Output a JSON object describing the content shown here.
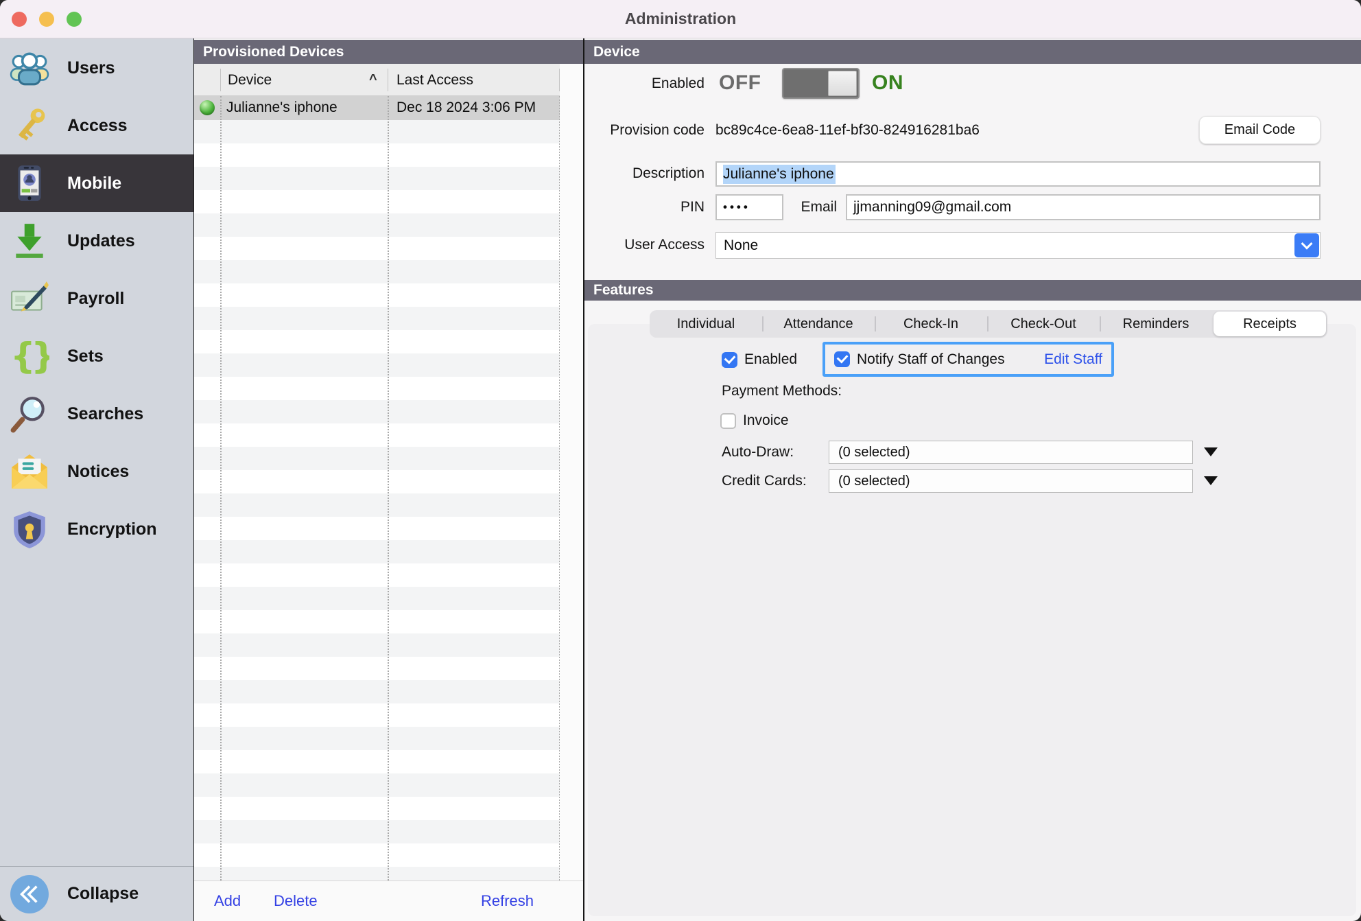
{
  "window": {
    "title": "Administration"
  },
  "sidebar": {
    "items": [
      {
        "label": "Users",
        "icon": "users-icon"
      },
      {
        "label": "Access",
        "icon": "key-icon"
      },
      {
        "label": "Mobile",
        "icon": "mobile-icon",
        "selected": true
      },
      {
        "label": "Updates",
        "icon": "download-icon"
      },
      {
        "label": "Payroll",
        "icon": "check-pen-icon"
      },
      {
        "label": "Sets",
        "icon": "braces-icon"
      },
      {
        "label": "Searches",
        "icon": "magnifier-icon"
      },
      {
        "label": "Notices",
        "icon": "envelope-icon"
      },
      {
        "label": "Encryption",
        "icon": "shield-icon"
      }
    ],
    "collapse_label": "Collapse"
  },
  "devices_panel": {
    "header": "Provisioned Devices",
    "table": {
      "columns": [
        "Device",
        "Last Access"
      ],
      "sort_indicator": "^",
      "rows": [
        {
          "status": "online",
          "device": "Julianne's iphone",
          "last_access": "Dec 18 2024 3:06 PM"
        }
      ]
    },
    "actions": {
      "add": "Add",
      "delete": "Delete",
      "refresh": "Refresh"
    }
  },
  "device_panel": {
    "header": "Device",
    "enabled": {
      "label": "Enabled",
      "off": "OFF",
      "on": "ON",
      "state": "on"
    },
    "provision": {
      "label": "Provision code",
      "value": "bc89c4ce-6ea8-11ef-bf30-824916281ba6",
      "email_code_button": "Email Code"
    },
    "description": {
      "label": "Description",
      "value": "Julianne's iphone"
    },
    "pin": {
      "label": "PIN",
      "value": "••••"
    },
    "email": {
      "label": "Email",
      "value": "jjmanning09@gmail.com"
    },
    "user_access": {
      "label": "User Access",
      "value": "None"
    }
  },
  "features_panel": {
    "header": "Features",
    "tabs": [
      "Individual",
      "Attendance",
      "Check-In",
      "Check-Out",
      "Reminders",
      "Receipts"
    ],
    "selected_tab": "Receipts",
    "receipts": {
      "enabled_label": "Enabled",
      "enabled_checked": true,
      "notify_label": "Notify Staff of Changes",
      "notify_checked": true,
      "edit_staff_link": "Edit Staff",
      "payment_methods_label": "Payment Methods:",
      "invoice_label": "Invoice",
      "invoice_checked": false,
      "auto_draw_label": "Auto-Draw:",
      "auto_draw_value": "(0 selected)",
      "credit_cards_label": "Credit Cards:",
      "credit_cards_value": "(0 selected)"
    }
  },
  "colors": {
    "header_bar": "#6a6876",
    "sidebar_bg": "#d2d6dd",
    "selected_item_bg": "#38353a",
    "accent_blue": "#3376f3",
    "link_blue": "#3340e4",
    "on_green": "#37821f",
    "highlight_box_border": "#4aa0f8",
    "selection_highlight": "#b3d5f9"
  }
}
